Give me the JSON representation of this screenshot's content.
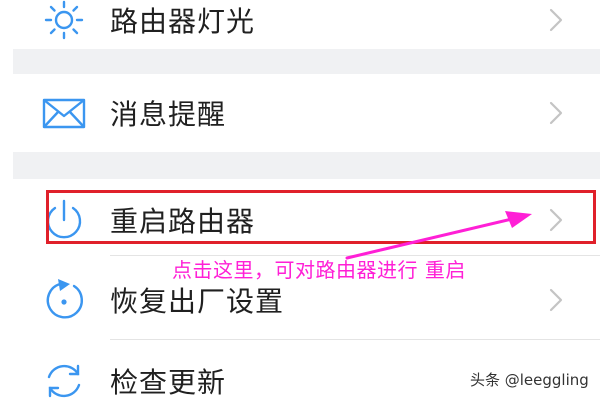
{
  "settings": {
    "items": [
      {
        "label": "路由器灯光",
        "icon": "sun-icon"
      },
      {
        "label": "消息提醒",
        "icon": "envelope-icon"
      },
      {
        "label": "重启路由器",
        "icon": "power-icon"
      },
      {
        "label": "恢复出厂设置",
        "icon": "restore-icon"
      },
      {
        "label": "检查更新",
        "icon": "refresh-icon"
      }
    ]
  },
  "annotation": {
    "text": "点击这里，可对路由器进行 重启",
    "color": "#ff1fd6",
    "highlight_color": "#e0202a"
  },
  "watermark": {
    "text": "头条 @leeggling"
  },
  "colors": {
    "icon_blue": "#3b96f0",
    "chevron": "#c4c4c4",
    "separator": "#f0f1f3"
  }
}
